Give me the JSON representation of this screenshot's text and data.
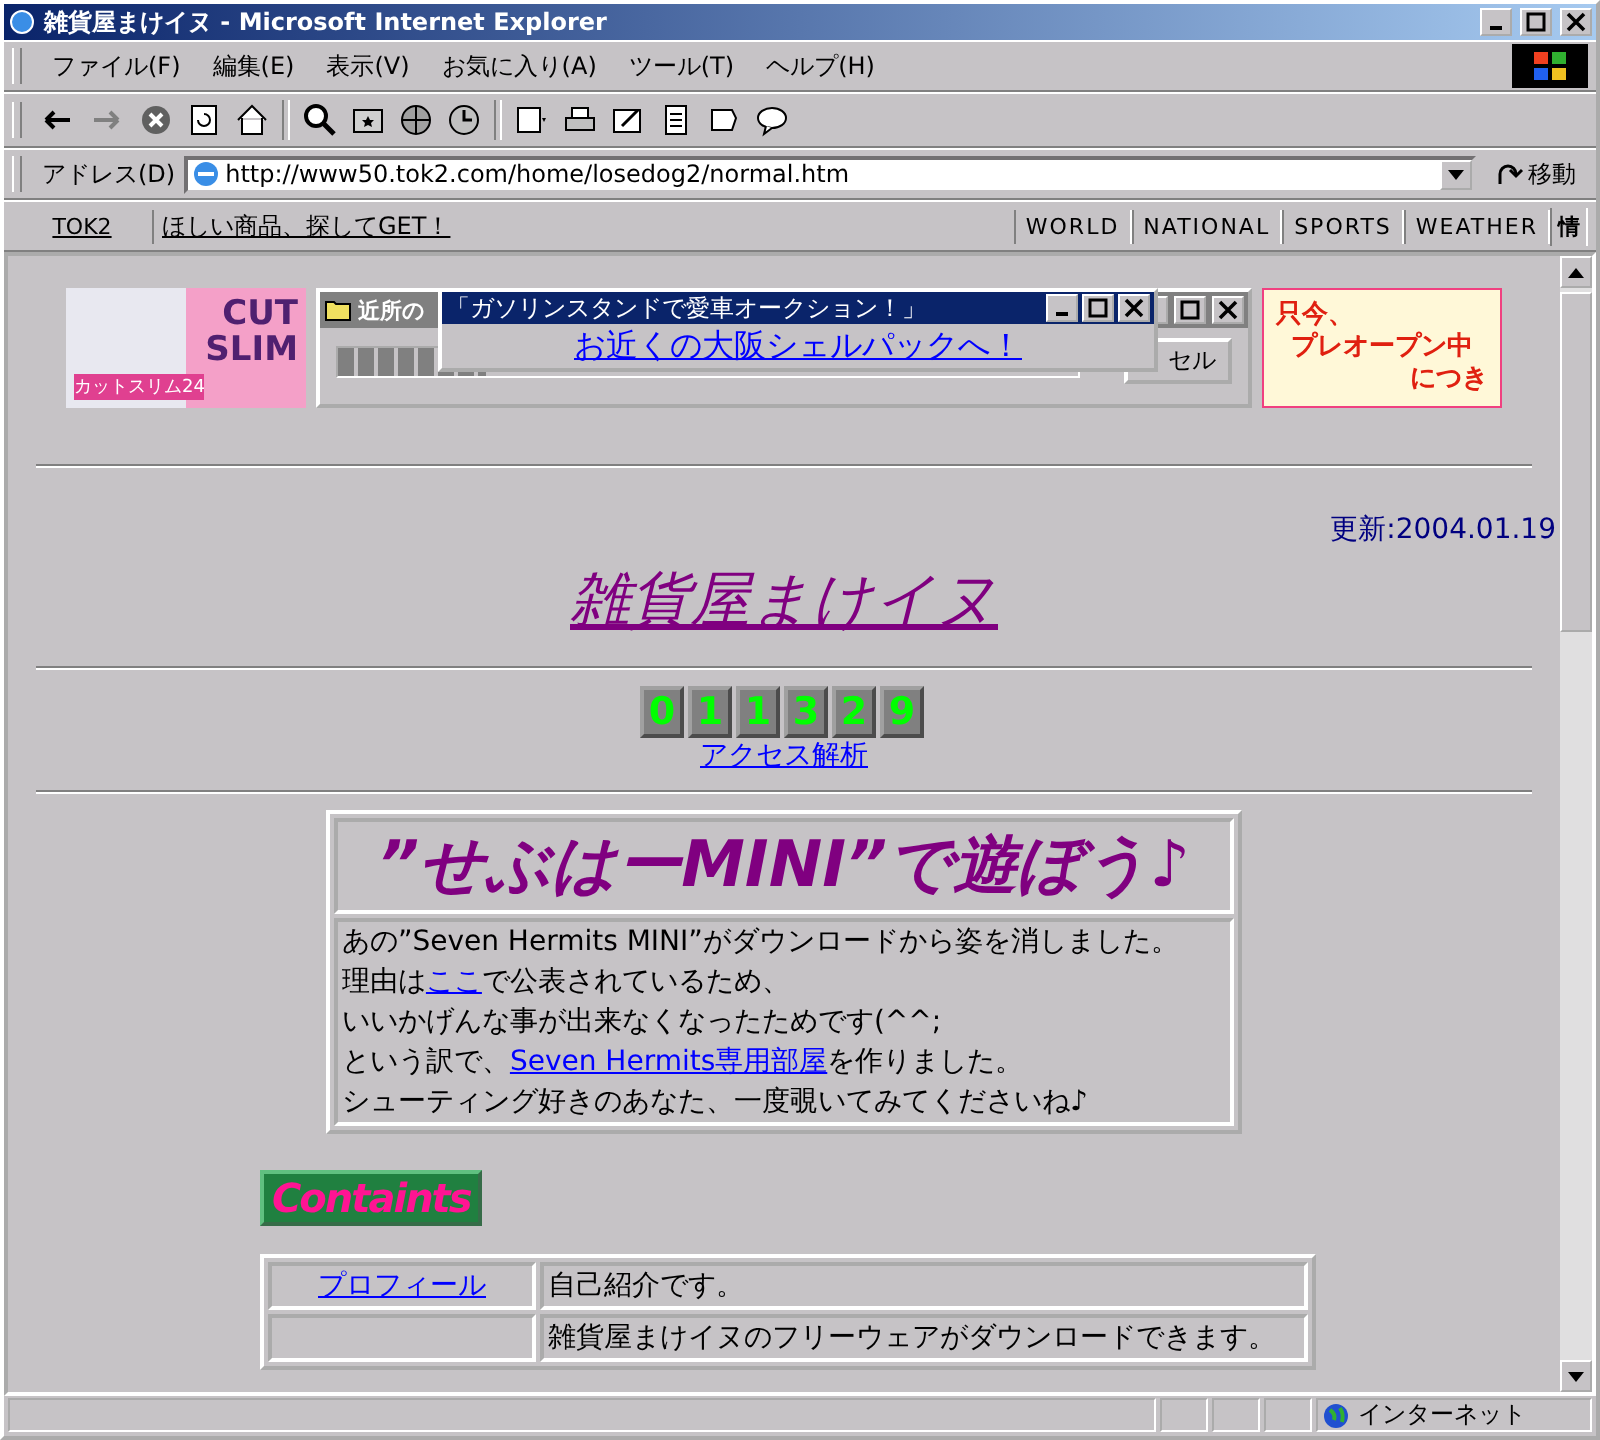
{
  "window": {
    "title": "雑貨屋まけイヌ - Microsoft Internet Explorer"
  },
  "menu": [
    "ファイル(F)",
    "編集(E)",
    "表示(V)",
    "お気に入り(A)",
    "ツール(T)",
    "ヘルプ(H)"
  ],
  "address": {
    "label": "アドレス(D)",
    "value": "http://www50.tok2.com/home/losedog2/normal.htm",
    "go": "移動"
  },
  "links_bar": {
    "home": "TOK2",
    "promo": "ほしい商品、探してGET！",
    "sections": [
      "WORLD",
      "NATIONAL",
      "SPORTS",
      "WEATHER",
      "情"
    ]
  },
  "ads": {
    "left_banner": {
      "headline": "CUT SLIM",
      "caption": "カットスリム24"
    },
    "download_window": {
      "title": "近所の",
      "button": "セル",
      "level": 0.2
    },
    "popup": {
      "title": "「ガソリンスタンドで愛車オークション！」",
      "link": "お近くの大阪シェルパックへ！"
    },
    "right_banner": {
      "lines": [
        "只今、",
        "プレオープン中",
        "につき"
      ]
    }
  },
  "updated": "更新:2004.01.19",
  "site_title": "雑貨屋まけイヌ",
  "counter": {
    "digits": [
      "0",
      "1",
      "1",
      "3",
      "2",
      "9"
    ],
    "link": "アクセス解析"
  },
  "notice": {
    "heading": "”せぶはーMINI”で遊ぼう♪",
    "lines": [
      [
        {
          "kind": "text",
          "text": "あの”Seven Hermits MINI”がダウンロードから姿を消しました。"
        }
      ],
      [
        {
          "kind": "text",
          "text": "理由は"
        },
        {
          "kind": "link",
          "text": "ここ"
        },
        {
          "kind": "text",
          "text": "で公表されているため、"
        }
      ],
      [
        {
          "kind": "text",
          "text": "いいかげんな事が出来なくなったためです(^^;"
        }
      ],
      [
        {
          "kind": "text",
          "text": "という訳で、"
        },
        {
          "kind": "link",
          "text": "Seven Hermits専用部屋"
        },
        {
          "kind": "text",
          "text": "を作りました。"
        }
      ],
      [
        {
          "kind": "text",
          "text": "シューティング好きのあなた、一度覗いてみてくださいね♪"
        }
      ]
    ]
  },
  "contents_label": "Containts",
  "contents": [
    {
      "link": "プロフィール",
      "description": "自己紹介です。"
    },
    {
      "description": "雑貨屋まけイヌのフリーウェアがダウンロードできます。"
    }
  ],
  "status_bar": {
    "zone": "インターネット"
  }
}
